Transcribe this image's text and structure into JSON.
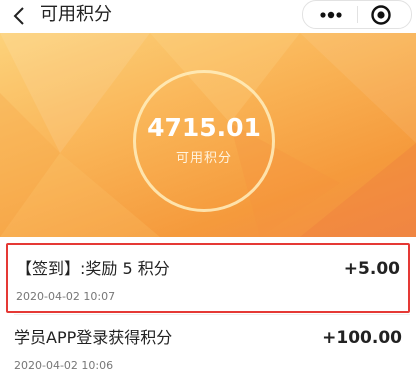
{
  "nav": {
    "title": "可用积分",
    "back_icon": "chevron-left-icon",
    "more_icon": "more-dots-icon",
    "close_icon": "target-close-icon"
  },
  "summary": {
    "points": "4715.01",
    "label": "可用积分"
  },
  "records": [
    {
      "title": "【签到】:奖励 5 积分",
      "amount": "+5.00",
      "time": "2020-04-02 10:07",
      "highlighted": true
    },
    {
      "title": "学员APP登录获得积分",
      "amount": "+100.00",
      "time": "2020-04-02 10:06",
      "highlighted": false
    }
  ],
  "colors": {
    "hero_start": "#fcd27b",
    "hero_end": "#f28b45",
    "highlight_border": "#e53935"
  }
}
